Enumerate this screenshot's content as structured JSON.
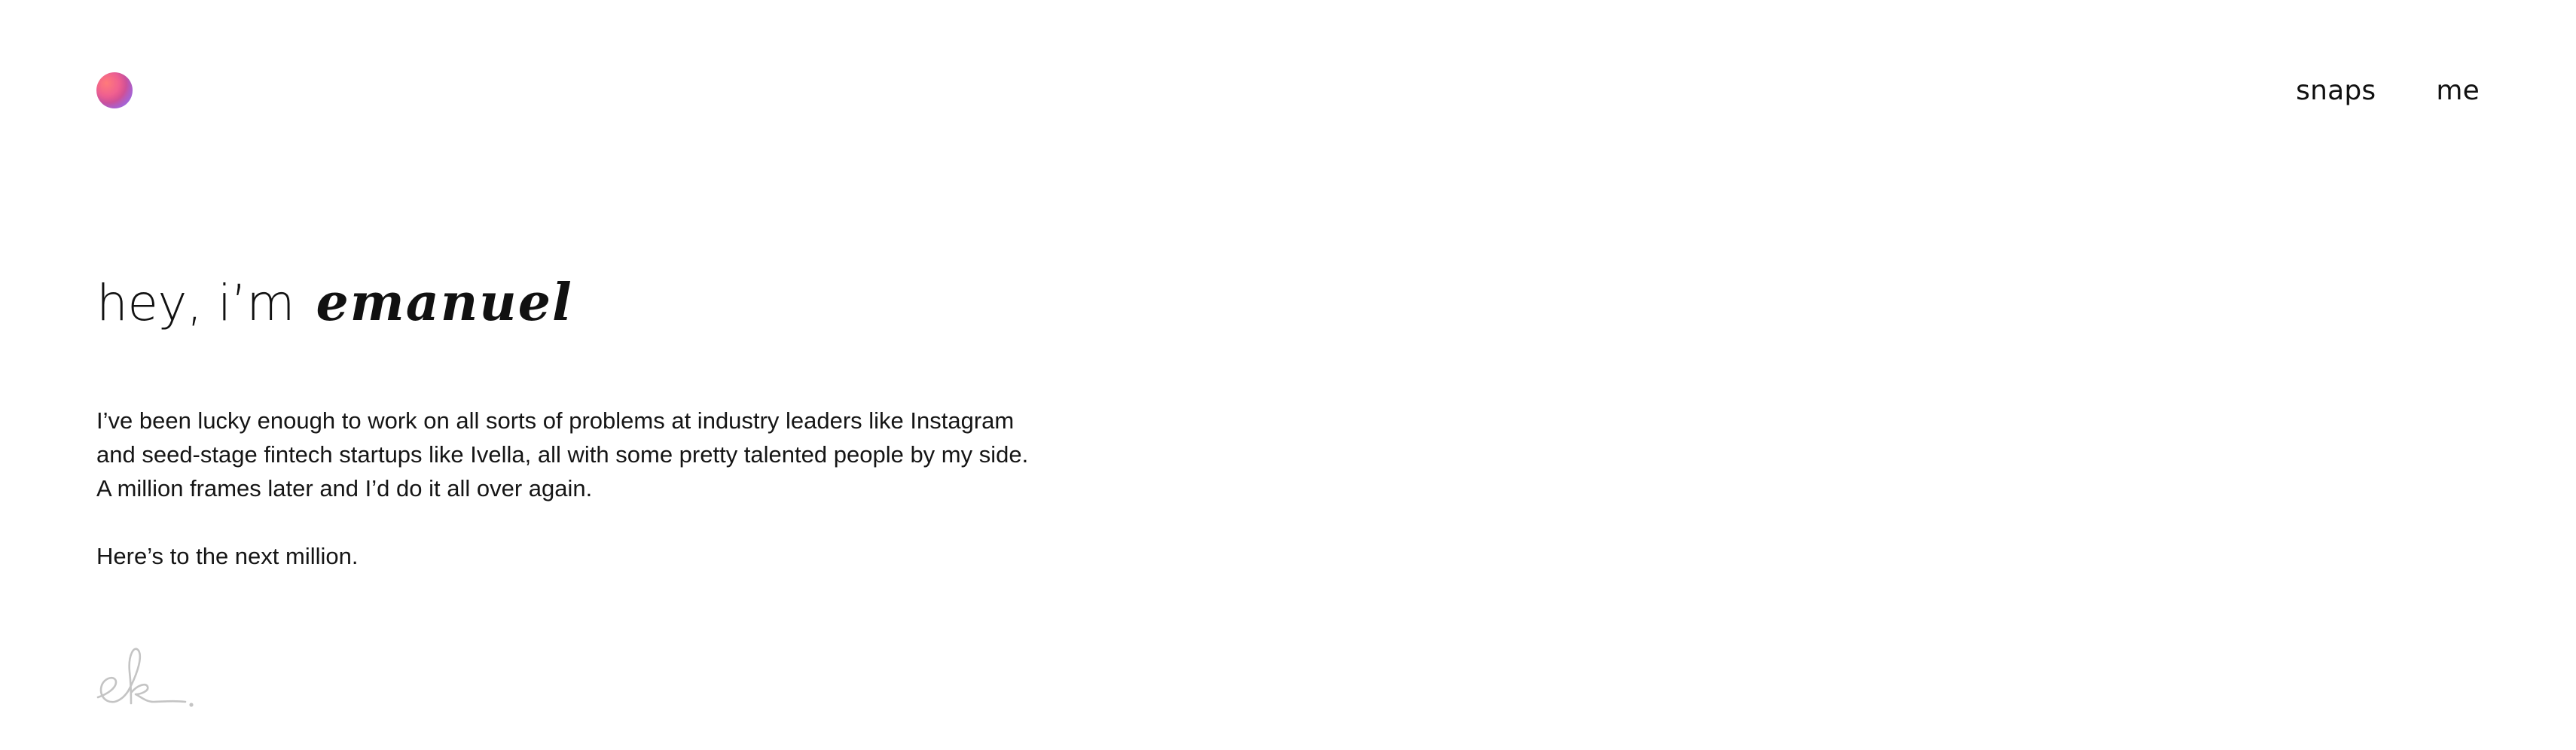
{
  "header": {
    "logo_icon": "gradient-orb-icon",
    "logo_colors": [
      "#ff7a7a",
      "#d9508f",
      "#8f8cf0"
    ],
    "nav": [
      {
        "label": "snaps"
      },
      {
        "label": "me"
      }
    ]
  },
  "hero": {
    "greeting": "hey, i’m",
    "name": "emanuel"
  },
  "bio": {
    "lines": [
      "I’ve been lucky enough to work on all sorts of problems at industry leaders like Instagram",
      "and seed-stage fintech startups like Ivella, all with some pretty talented people by my side.",
      "A million frames later and I’d do it all over again."
    ],
    "closing": "Here’s to the next million."
  },
  "signature": {
    "text": "ek.",
    "color": "#c4c4c4"
  }
}
